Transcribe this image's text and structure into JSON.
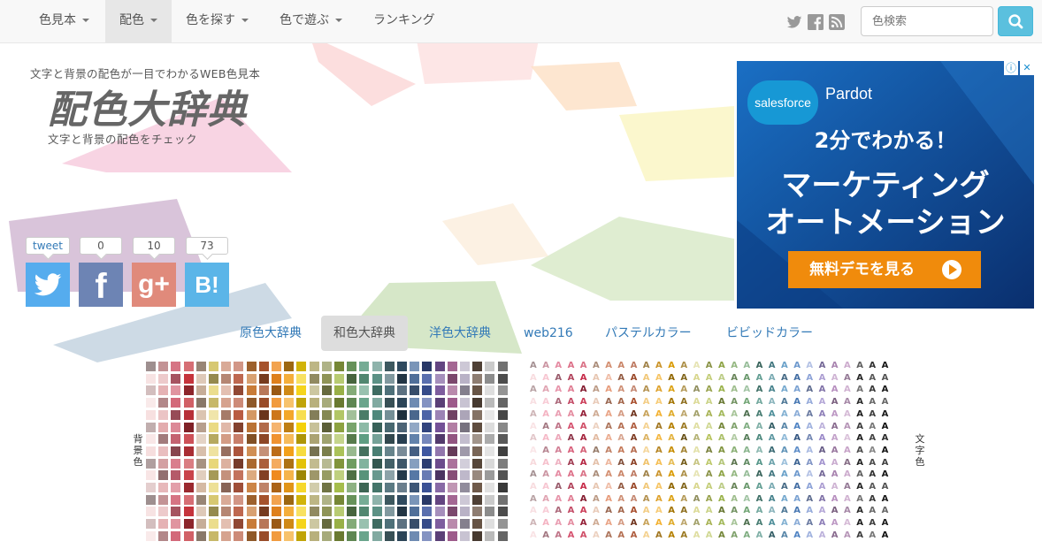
{
  "nav": {
    "items": [
      {
        "label": "色見本",
        "caret": true,
        "active": false
      },
      {
        "label": "配色",
        "caret": true,
        "active": true
      },
      {
        "label": "色を探す",
        "caret": true,
        "active": false
      },
      {
        "label": "色で遊ぶ",
        "caret": true,
        "active": false
      },
      {
        "label": "ランキング",
        "caret": false,
        "active": false
      }
    ],
    "social_icons": [
      "twitter-icon",
      "facebook-icon",
      "rss-icon"
    ],
    "search_placeholder": "色検索"
  },
  "header": {
    "tagline": "文字と背景の配色が一目でわかるWEB色見本",
    "logo": "配色大辞典",
    "subtitle": "文字と背景の配色をチェック"
  },
  "share": {
    "counts": [
      "tweet",
      "0",
      "10",
      "73"
    ],
    "buttons": [
      {
        "name": "twitter",
        "glyph": "",
        "color": "#55acee"
      },
      {
        "name": "facebook",
        "glyph": "f",
        "color": "#6d84b4"
      },
      {
        "name": "google-plus",
        "glyph": "g+",
        "color": "#e08a7b"
      },
      {
        "name": "hatena",
        "glyph": "B!",
        "color": "#5bb5e8"
      }
    ]
  },
  "ad": {
    "brand": "salesforce",
    "product": "Pardot",
    "line1": "2分でわかる！",
    "line2": "マーケティング",
    "line3": "オートメーション",
    "cta": "無料デモを見る",
    "info_icon": "ⓘ",
    "close_icon": "✕"
  },
  "tabs": [
    {
      "label": "原色大辞典",
      "active": false
    },
    {
      "label": "和色大辞典",
      "active": true
    },
    {
      "label": "洋色大辞典",
      "active": false
    },
    {
      "label": "web216",
      "active": false
    },
    {
      "label": "パステルカラー",
      "active": false
    },
    {
      "label": "ビビッドカラー",
      "active": false
    }
  ],
  "labels": {
    "background": "背景色",
    "text": "文字色"
  },
  "swatch_letter": "A",
  "colors": {
    "accent": "#5bc0de",
    "link": "#337ab7",
    "bg_pink": "#f5b6d0",
    "bg_purple": "#c5a6c9",
    "bg_blue": "#b7cad9",
    "bg_green": "#cfe3b5",
    "bg_peach": "#f9d9b8",
    "bg_yellow": "#f7f3b0",
    "bg_red": "#fad0d0",
    "swatch_columns": [
      "#f6dede",
      "#e3acae",
      "#d3697a",
      "#c5343c",
      "#d5baa4",
      "#e8d77a",
      "#d39c86",
      "#b95c42",
      "#c87c39",
      "#a5522c",
      "#ef8a1f",
      "#f2a01a",
      "#f4d10a",
      "#b8b07c",
      "#8f9457",
      "#a5bd4c",
      "#6f9d61",
      "#5f9e83",
      "#4f887c",
      "#4e7079",
      "#2f4a5f",
      "#5678a5",
      "#3f57a0",
      "#745197",
      "#9d5b8b",
      "#b9b2c6",
      "#6f5a4a",
      "#d9d9d9",
      "#595959"
    ],
    "letter_columns": [
      "#f7d9dc",
      "#f4b3c2",
      "#e58aa2",
      "#d65370",
      "#c72c4a",
      "#e2baa1",
      "#e79c7b",
      "#c57a5a",
      "#a84e2d",
      "#f0c36c",
      "#f3b233",
      "#d99a00",
      "#9c7a23",
      "#d9d78e",
      "#b8c45f",
      "#9ab24a",
      "#8ab075",
      "#73a676",
      "#56968a",
      "#4f8f9a",
      "#6aa1c9",
      "#4f83c3",
      "#8ea4d8",
      "#9b8ac9",
      "#b78fbf",
      "#c7a3c8",
      "#2b2b2b",
      "#4a4a4a",
      "#1a1a1a"
    ]
  }
}
